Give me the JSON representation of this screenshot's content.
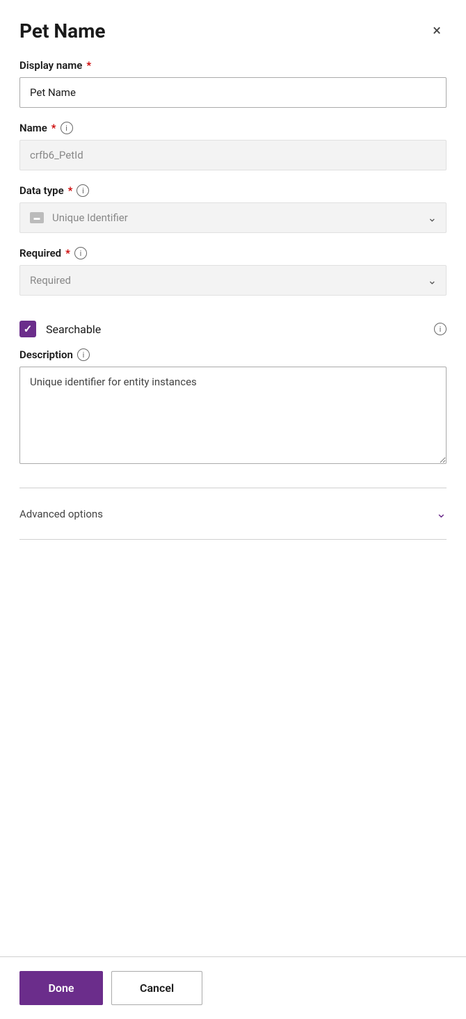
{
  "header": {
    "title": "Pet Name",
    "close_label": "×"
  },
  "display_name": {
    "label": "Display name",
    "required": true,
    "value": "Pet Name",
    "placeholder": "Pet Name"
  },
  "name": {
    "label": "Name",
    "required": true,
    "value": "crfb6_PetId",
    "placeholder": "crfb6_PetId",
    "info": "i"
  },
  "data_type": {
    "label": "Data type",
    "required": true,
    "value": "Unique Identifier",
    "info": "i"
  },
  "required_field": {
    "label": "Required",
    "required": true,
    "value": "Required",
    "info": "i"
  },
  "searchable": {
    "label": "Searchable",
    "checked": true,
    "info": "i"
  },
  "description": {
    "label": "Description",
    "value": "Unique identifier for entity instances",
    "info": "i"
  },
  "advanced_options": {
    "label": "Advanced options"
  },
  "footer": {
    "done_label": "Done",
    "cancel_label": "Cancel"
  }
}
